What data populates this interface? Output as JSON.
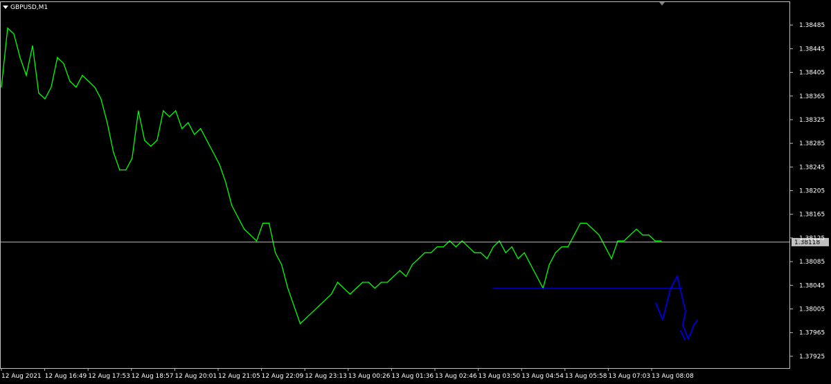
{
  "window": {
    "symbol_label": "GBPUSD,M1"
  },
  "colors": {
    "background": "#000000",
    "frame": "#c0c0c0",
    "price_line": "#00ff00",
    "bid_line": "#c0c0c0",
    "drawing": "#0000cc",
    "text": "#ffffff",
    "bid_label_bg": "#c0c0c0",
    "bid_label_text": "#000000"
  },
  "icons": {
    "symbol_menu": "triangle-down-icon",
    "chart_shift": "triangle-down-icon"
  },
  "chart_data": {
    "type": "line",
    "title": "GBPUSD,M1",
    "ylim": [
      1.37905,
      1.38525
    ],
    "y_ticks": [
      1.38485,
      1.38445,
      1.38405,
      1.38365,
      1.38325,
      1.38285,
      1.38245,
      1.38205,
      1.38165,
      1.38125,
      1.38085,
      1.38045,
      1.38005,
      1.37965,
      1.37925
    ],
    "y_tick_labels": [
      "1.38485",
      "1.38445",
      "1.38405",
      "1.38365",
      "1.38325",
      "1.38285",
      "1.38245",
      "1.38205",
      "1.38165",
      "1.38125",
      "1.38085",
      "1.38045",
      "1.38005",
      "1.37965",
      "1.37925"
    ],
    "x_tick_labels": [
      "12 Aug 2021",
      "12 Aug 16:49",
      "12 Aug 17:53",
      "12 Aug 18:57",
      "12 Aug 20:01",
      "12 Aug 21:05",
      "12 Aug 22:09",
      "12 Aug 23:13",
      "13 Aug 00:26",
      "13 Aug 01:36",
      "13 Aug 02:46",
      "13 Aug 03:50",
      "13 Aug 04:54",
      "13 Aug 05:58",
      "13 Aug 07:03",
      "13 Aug 08:08"
    ],
    "bid_price": 1.38118,
    "bid_label": "1.38118",
    "series": [
      {
        "values": [
          1.3838,
          1.3848,
          1.3847,
          1.3843,
          1.384,
          1.3845,
          1.3837,
          1.3836,
          1.3838,
          1.3843,
          1.3842,
          1.3839,
          1.3838,
          1.384,
          1.3839,
          1.3838,
          1.3836,
          1.3832,
          1.3827,
          1.3824,
          1.3824,
          1.3826,
          1.3834,
          1.3829,
          1.3828,
          1.3829,
          1.3834,
          1.3833,
          1.3834,
          1.3831,
          1.3832,
          1.383,
          1.3831,
          1.3829,
          1.3827,
          1.3825,
          1.3822,
          1.3818,
          1.3816,
          1.3814,
          1.3813,
          1.3812,
          1.3815,
          1.3815,
          1.381,
          1.3808,
          1.3804,
          1.3801,
          1.3798,
          1.3799,
          1.38,
          1.3801,
          1.3802,
          1.3803,
          1.3805,
          1.3804,
          1.3803,
          1.3804,
          1.3805,
          1.3805,
          1.3804,
          1.3805,
          1.3805,
          1.3806,
          1.3807,
          1.3806,
          1.3808,
          1.3809,
          1.381,
          1.381,
          1.3811,
          1.3811,
          1.3812,
          1.3811,
          1.3812,
          1.3811,
          1.381,
          1.381,
          1.3809,
          1.3811,
          1.3812,
          1.381,
          1.3811,
          1.3809,
          1.381,
          1.3808,
          1.3806,
          1.3804,
          1.3808,
          1.381,
          1.3811,
          1.3811,
          1.3813,
          1.3815,
          1.3815,
          1.3814,
          1.3813,
          1.3811,
          1.3809,
          1.3812,
          1.3812,
          1.3813,
          1.3814,
          1.3813,
          1.3813,
          1.3812,
          1.3812
        ]
      }
    ],
    "annotations": {
      "level_price": 1.3804
    }
  }
}
